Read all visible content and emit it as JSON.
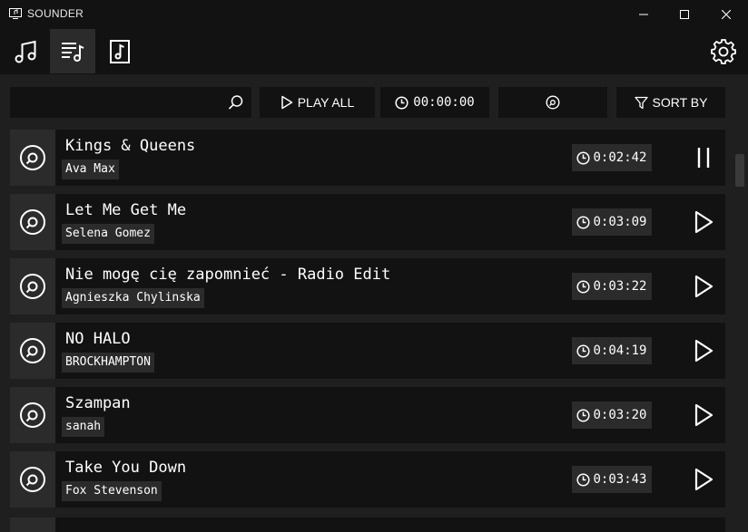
{
  "window": {
    "title": "SOUNDER",
    "controls": [
      "minimize",
      "maximize",
      "close"
    ]
  },
  "nav": {
    "tabs": [
      {
        "icon": "music-note-icon",
        "active": false
      },
      {
        "icon": "playlist-icon",
        "active": true
      },
      {
        "icon": "music-file-icon",
        "active": false
      }
    ],
    "settings_icon": "gear-icon"
  },
  "toolbar": {
    "search_value": "",
    "play_all_label": "PLAY ALL",
    "total_duration": "00:00:00",
    "sort_label": "SORT BY"
  },
  "songs": [
    {
      "title": "Kings & Queens",
      "artist": "Ava Max",
      "duration": "0:02:42",
      "state": "playing"
    },
    {
      "title": "Let Me Get Me",
      "artist": "Selena Gomez",
      "duration": "0:03:09",
      "state": "stopped"
    },
    {
      "title": "Nie mogę cię zapomnieć - Radio Edit",
      "artist": "Agnieszka Chylinska",
      "duration": "0:03:22",
      "state": "stopped"
    },
    {
      "title": "NO HALO",
      "artist": "BROCKHAMPTON",
      "duration": "0:04:19",
      "state": "stopped"
    },
    {
      "title": "Szampan",
      "artist": "sanah",
      "duration": "0:03:20",
      "state": "stopped"
    },
    {
      "title": "Take You Down",
      "artist": "Fox Stevenson",
      "duration": "0:03:43",
      "state": "stopped"
    }
  ],
  "colors": {
    "background": "#121212",
    "surface": "#1f1f1f",
    "highlight": "#2b2b2b",
    "text": "#ffffff"
  }
}
